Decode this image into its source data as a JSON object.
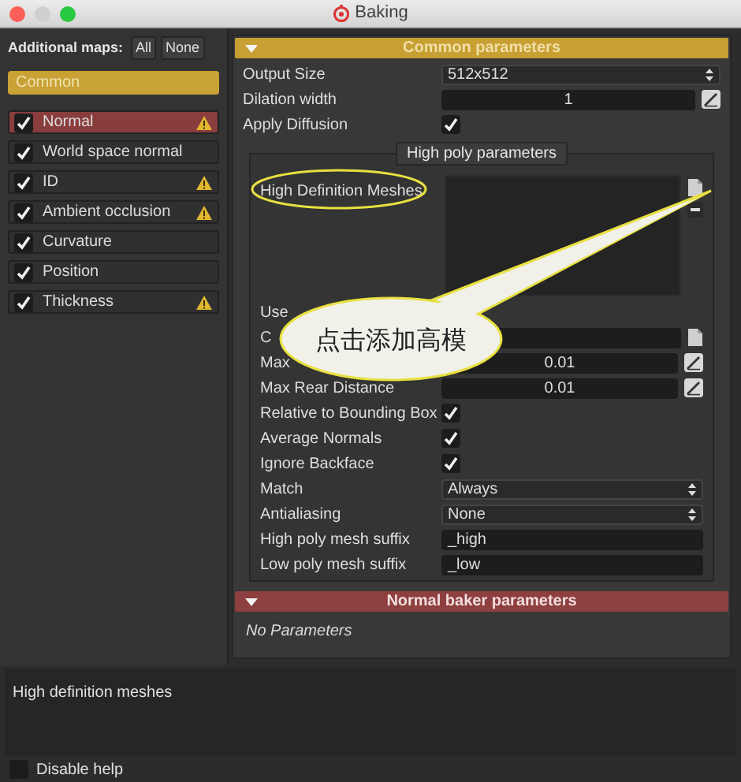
{
  "window": {
    "title": "Baking"
  },
  "sidebar": {
    "label": "Additional maps:",
    "buttons": [
      "All",
      "None"
    ],
    "group": {
      "label": "Common",
      "selected": true
    },
    "maps": [
      {
        "label": "Normal",
        "checked": true,
        "selected": true,
        "warning": true
      },
      {
        "label": "World space normal",
        "checked": true,
        "selected": false,
        "warning": false
      },
      {
        "label": "ID",
        "checked": true,
        "selected": false,
        "warning": true
      },
      {
        "label": "Ambient occlusion",
        "checked": true,
        "selected": false,
        "warning": true
      },
      {
        "label": "Curvature",
        "checked": true,
        "selected": false,
        "warning": false
      },
      {
        "label": "Position",
        "checked": true,
        "selected": false,
        "warning": false
      },
      {
        "label": "Thickness",
        "checked": true,
        "selected": false,
        "warning": true
      }
    ]
  },
  "common": {
    "title": "Common parameters",
    "expanded": true,
    "fields": [
      {
        "kind": "select",
        "label": "Output Size",
        "value": "512x512"
      },
      {
        "kind": "number",
        "label": "Dilation width",
        "value": "1"
      },
      {
        "kind": "checkbox",
        "label": "Apply Diffusion",
        "checked": true
      }
    ]
  },
  "high_poly": {
    "title": "High poly parameters",
    "meshes_label": "High Definition Meshes",
    "fields": [
      {
        "kind": "label",
        "label": "Use"
      },
      {
        "kind": "file",
        "label": "C"
      },
      {
        "kind": "number",
        "label": "Max",
        "value": "0.01"
      },
      {
        "kind": "number",
        "label": "Max Rear Distance",
        "value": "0.01"
      },
      {
        "kind": "checkbox",
        "label": "Relative to Bounding Box",
        "checked": true
      },
      {
        "kind": "checkbox",
        "label": "Average Normals",
        "checked": true
      },
      {
        "kind": "checkbox",
        "label": "Ignore Backface",
        "checked": true
      },
      {
        "kind": "select",
        "label": "Match",
        "value": "Always"
      },
      {
        "kind": "select",
        "label": "Antialiasing",
        "value": "None"
      },
      {
        "kind": "text",
        "label": "High poly mesh suffix",
        "value": "_high"
      },
      {
        "kind": "text",
        "label": "Low poly mesh suffix",
        "value": "_low"
      }
    ]
  },
  "callout": {
    "text": "点击添加高模"
  },
  "normal_baker": {
    "title": "Normal baker parameters",
    "expanded": true,
    "empty_text": "No Parameters"
  },
  "help": {
    "text": "High definition meshes"
  },
  "disable_help": {
    "label": "Disable help",
    "checked": false
  }
}
